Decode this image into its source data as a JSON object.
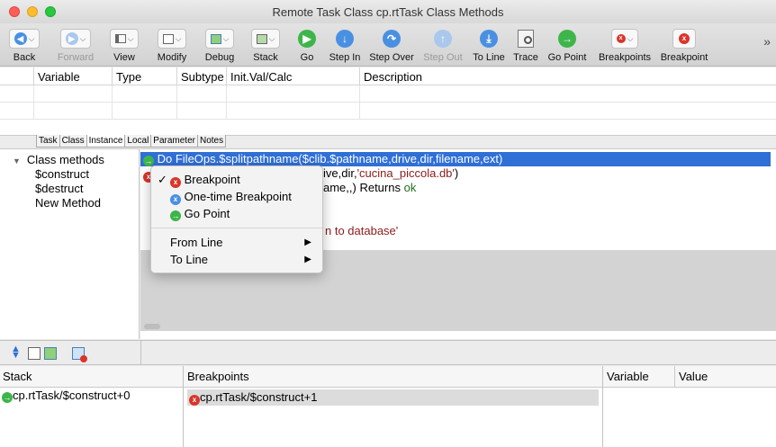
{
  "window": {
    "title": "Remote Task Class cp.rtTask Class Methods"
  },
  "toolbar": {
    "buttons": [
      {
        "label": "Back",
        "icon": "back-arrow-icon",
        "enabled": true
      },
      {
        "label": "Forward",
        "icon": "forward-arrow-icon",
        "enabled": false
      },
      {
        "label": "View",
        "icon": "view-icon",
        "enabled": true
      },
      {
        "label": "Modify",
        "icon": "modify-icon",
        "enabled": true
      },
      {
        "label": "Debug",
        "icon": "debug-icon",
        "enabled": true
      },
      {
        "label": "Stack",
        "icon": "stack-icon",
        "enabled": true
      },
      {
        "label": "Go",
        "icon": "go-play-icon",
        "enabled": true
      },
      {
        "label": "Step In",
        "icon": "step-in-icon",
        "enabled": true
      },
      {
        "label": "Step Over",
        "icon": "step-over-icon",
        "enabled": true
      },
      {
        "label": "Step Out",
        "icon": "step-out-icon",
        "enabled": false
      },
      {
        "label": "To Line",
        "icon": "to-line-icon",
        "enabled": true
      },
      {
        "label": "Trace",
        "icon": "trace-icon",
        "enabled": true
      },
      {
        "label": "Go Point",
        "icon": "go-point-icon",
        "enabled": true
      },
      {
        "label": "Breakpoints",
        "icon": "breakpoints-icon",
        "enabled": true
      },
      {
        "label": "Breakpoint",
        "icon": "breakpoint-icon",
        "enabled": true
      }
    ],
    "overflow": "»"
  },
  "variables": {
    "columns": [
      "Variable",
      "Type",
      "Subtype",
      "Init.Val/Calc",
      "Description"
    ]
  },
  "tabs": [
    "Task",
    "Class",
    "Instance",
    "Local",
    "Parameter",
    "Notes"
  ],
  "tree": {
    "group": "Class methods",
    "items": [
      "$construct",
      "$destruct",
      "New Method"
    ]
  },
  "code": {
    "line1": "Do FileOps.$splitpathname($clib.$pathname,drive,dir,filename,ext)",
    "line2_plain": "ive,dir,",
    "line2_str": "'cucina_piccola.db'",
    "line2_end": ")",
    "line3_plain": "ame,,) Returns ",
    "line3_kw": "ok",
    "line6_plain": "n to database'"
  },
  "context_menu": {
    "items": [
      {
        "label": "Breakpoint",
        "checked": true,
        "icon": "breakpoint-red-icon"
      },
      {
        "label": "One-time Breakpoint",
        "checked": false,
        "icon": "one-time-breakpoint-icon"
      },
      {
        "label": "Go Point",
        "checked": false,
        "icon": "go-point-green-icon"
      }
    ],
    "submenus": [
      "From Line",
      "To Line"
    ]
  },
  "panes": {
    "stack": {
      "title": "Stack",
      "rows": [
        "cp.rtTask/$construct+0"
      ]
    },
    "breakpoints": {
      "title": "Breakpoints",
      "rows": [
        "cp.rtTask/$construct+1"
      ]
    },
    "values": {
      "columns": [
        "Variable",
        "Value"
      ]
    }
  },
  "colors": {
    "selection": "#2f6fd6",
    "go_green": "#3db54a",
    "breakpoint_red": "#d9352b",
    "step_blue": "#4a90e2"
  }
}
